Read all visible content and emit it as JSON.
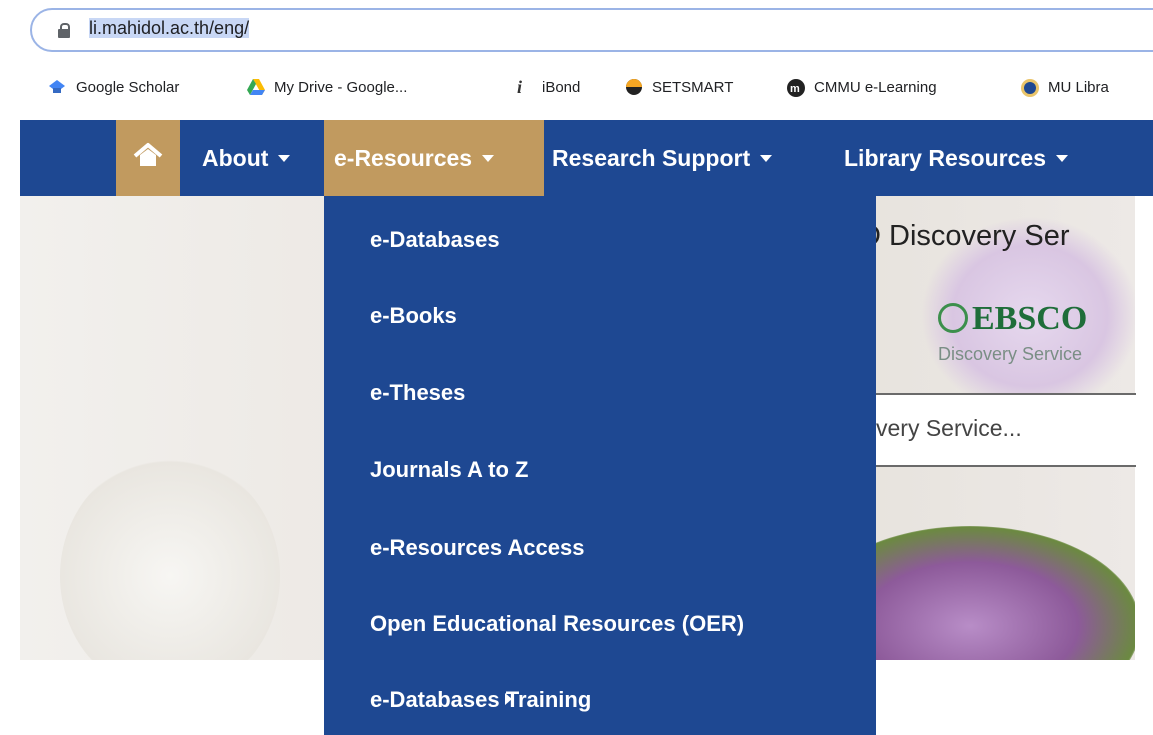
{
  "browser": {
    "url": "li.mahidol.ac.th/eng/"
  },
  "bookmarks": [
    {
      "label": "Google Scholar",
      "icon": "graduation-cap-icon"
    },
    {
      "label": "My Drive - Google...",
      "icon": "google-drive-icon"
    },
    {
      "label": "iBond",
      "icon": "ibond-icon"
    },
    {
      "label": "SETSMART",
      "icon": "setsmart-icon"
    },
    {
      "label": "CMMU e-Learning",
      "icon": "cmmu-icon"
    },
    {
      "label": "MU Libra",
      "icon": "mu-library-icon"
    }
  ],
  "nav": {
    "items": [
      {
        "label": "About"
      },
      {
        "label": "e-Resources"
      },
      {
        "label": "Research Support"
      },
      {
        "label": "Library Resources"
      }
    ]
  },
  "dropdown": {
    "items": [
      {
        "label": "e-Databases"
      },
      {
        "label": "e-Books"
      },
      {
        "label": "e-Theses"
      },
      {
        "label": "Journals A to Z"
      },
      {
        "label": "e-Resources Access"
      },
      {
        "label": "Open Educational Resources (OER)"
      },
      {
        "label": "e-Databases Training"
      }
    ]
  },
  "hero": {
    "title": "D Discovery Ser",
    "logo_text": "EBSCO",
    "logo_sub": "Discovery Service",
    "search_placeholder": "very Service..."
  },
  "colors": {
    "nav_bg": "#1e4892",
    "nav_active": "#c19a5f"
  }
}
